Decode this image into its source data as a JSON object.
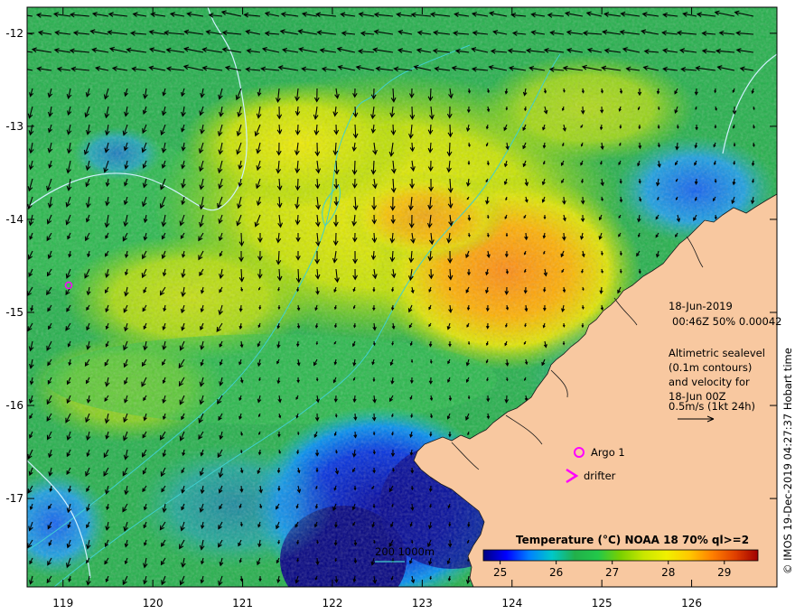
{
  "map": {
    "lon_ticks": [
      "119",
      "120",
      "121",
      "122",
      "123",
      "124",
      "125",
      "126"
    ],
    "lat_ticks": [
      "-12",
      "-13",
      "-14",
      "-15",
      "-16",
      "-17"
    ],
    "lon_range": [
      118.6,
      126.95
    ],
    "lat_range": [
      -17.95,
      -11.72
    ]
  },
  "info": {
    "date": "18-Jun-2019",
    "time_line": "00:46Z  50% 0.00042",
    "legend_lines": [
      "Altimetric sealevel",
      "(0.1m contours)",
      "and velocity for",
      "18-Jun 00Z",
      "0.5m/s (1kt 24h)"
    ]
  },
  "markers": {
    "argo_label": "Argo 1",
    "drifter_label": "drifter"
  },
  "bathymetry": {
    "label": "200  1000m"
  },
  "colorbar": {
    "title": "Temperature (°C) NOAA 18 70% ql>=2",
    "ticks": [
      "25",
      "26",
      "27",
      "28",
      "29"
    ],
    "range": [
      24.7,
      29.6
    ],
    "colors": [
      "#00007f",
      "#0000ff",
      "#0080ff",
      "#00c8c8",
      "#22b04a",
      "#22c84a",
      "#7ad000",
      "#c8e600",
      "#f0f000",
      "#ffc800",
      "#ff8000",
      "#e04000",
      "#a00000"
    ]
  },
  "credit": "© IMOS 19-Dec-2019 04:27:37 Hobart time",
  "colors": {
    "land": "#f8c8a0",
    "sst_warm": "#ff9a20",
    "sst_mid": "#6fd000",
    "sst_cool": "#1cb24a",
    "sst_cold": "#0000a0",
    "contour": "#d0f0ff",
    "bathy": "#40d0d0",
    "marker": "#ff00ff"
  }
}
